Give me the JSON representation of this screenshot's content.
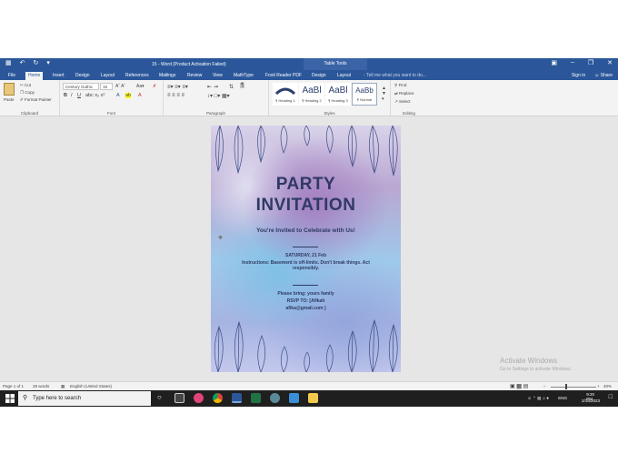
{
  "titlebar": {
    "doc_title": "15 - Word (Product Activation Failed)",
    "context_tab": "Table Tools"
  },
  "tabs": [
    {
      "label": "File"
    },
    {
      "label": "Home",
      "active": true
    },
    {
      "label": "Insert"
    },
    {
      "label": "Design"
    },
    {
      "label": "Layout"
    },
    {
      "label": "References"
    },
    {
      "label": "Mailings"
    },
    {
      "label": "Review"
    },
    {
      "label": "View"
    },
    {
      "label": "MathType"
    },
    {
      "label": "Foxit Reader PDF"
    },
    {
      "label": "Design"
    },
    {
      "label": "Layout"
    }
  ],
  "tell_me": "Tell me what you want to do...",
  "signin": "Sign in",
  "share": "Share",
  "ribbon": {
    "clipboard": {
      "paste": "Paste",
      "cut": "Cut",
      "copy": "Copy",
      "format_painter": "Format Painter",
      "label": "Clipboard"
    },
    "font": {
      "name": "Century Gothic",
      "size": "16",
      "label": "Font"
    },
    "paragraph": {
      "label": "Paragraph"
    },
    "styles": {
      "label": "Styles",
      "items": [
        {
          "sample": "",
          "caption": "¶ Heading 1"
        },
        {
          "sample": "AaBl",
          "caption": "¶ Heading 2"
        },
        {
          "sample": "AaBl",
          "caption": "¶ Heading 3"
        },
        {
          "sample": "AaBb",
          "caption": "¶ Normal"
        }
      ]
    },
    "editing": {
      "find": "Find",
      "replace": "Replace",
      "select": "Select",
      "label": "Editing"
    }
  },
  "document": {
    "title_line1": "PARTY",
    "title_line2": "INVITATION",
    "subtitle": "You're Invited to Celebrate with Us!",
    "date": "SATURDAY, 21 Feb",
    "instructions_1": "Instructions: Basement is off-limits. Don't break things. Act",
    "instructions_2": "responsibly.",
    "bring": "Please bring: yours family",
    "rsvp": "RSVP TO: [Afikah",
    "email": "afika@gmail.com ]"
  },
  "status": {
    "page": "Page 1 of 1",
    "words": "29 words",
    "language": "English (United States)",
    "zoom": "40%"
  },
  "watermark": {
    "line1": "Activate Windows",
    "line2": "Go to Settings to activate Windows."
  },
  "taskbar": {
    "search": "Type here to search",
    "language": "ENG",
    "time": "9:20 PM",
    "date": "2/15/2023"
  },
  "colors": {
    "word_blue": "#2b579a",
    "ink": "#2f3a63"
  }
}
